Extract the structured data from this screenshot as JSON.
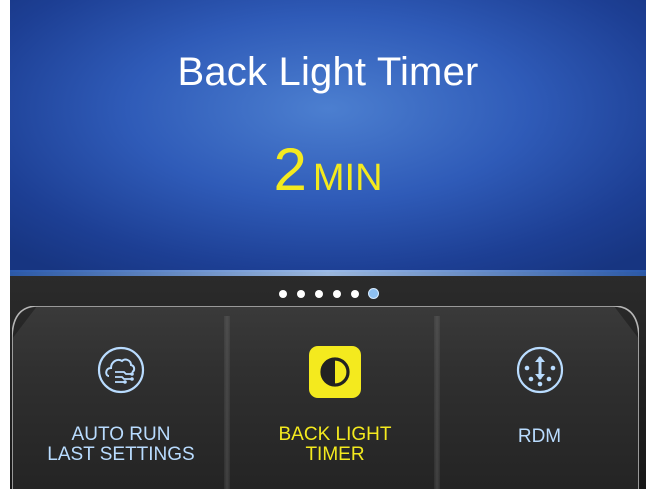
{
  "header": {
    "title": "Back Light Timer",
    "value_number": "2",
    "value_unit": "MIN"
  },
  "pager": {
    "total": 6,
    "active_index": 5
  },
  "menu": {
    "items": [
      {
        "line1": "AUTO RUN",
        "line2": "LAST SETTINGS",
        "icon": "auto-run-cloud-icon",
        "active": false
      },
      {
        "line1": "BACK LIGHT",
        "line2": "TIMER",
        "icon": "contrast-icon",
        "active": true
      },
      {
        "line1": "RDM",
        "line2": "",
        "icon": "rdm-connector-icon",
        "active": false
      }
    ]
  },
  "colors": {
    "accent_yellow": "#f4ea1e",
    "label_blue": "#b9dcff",
    "header_blue": "#2f5bb8"
  }
}
